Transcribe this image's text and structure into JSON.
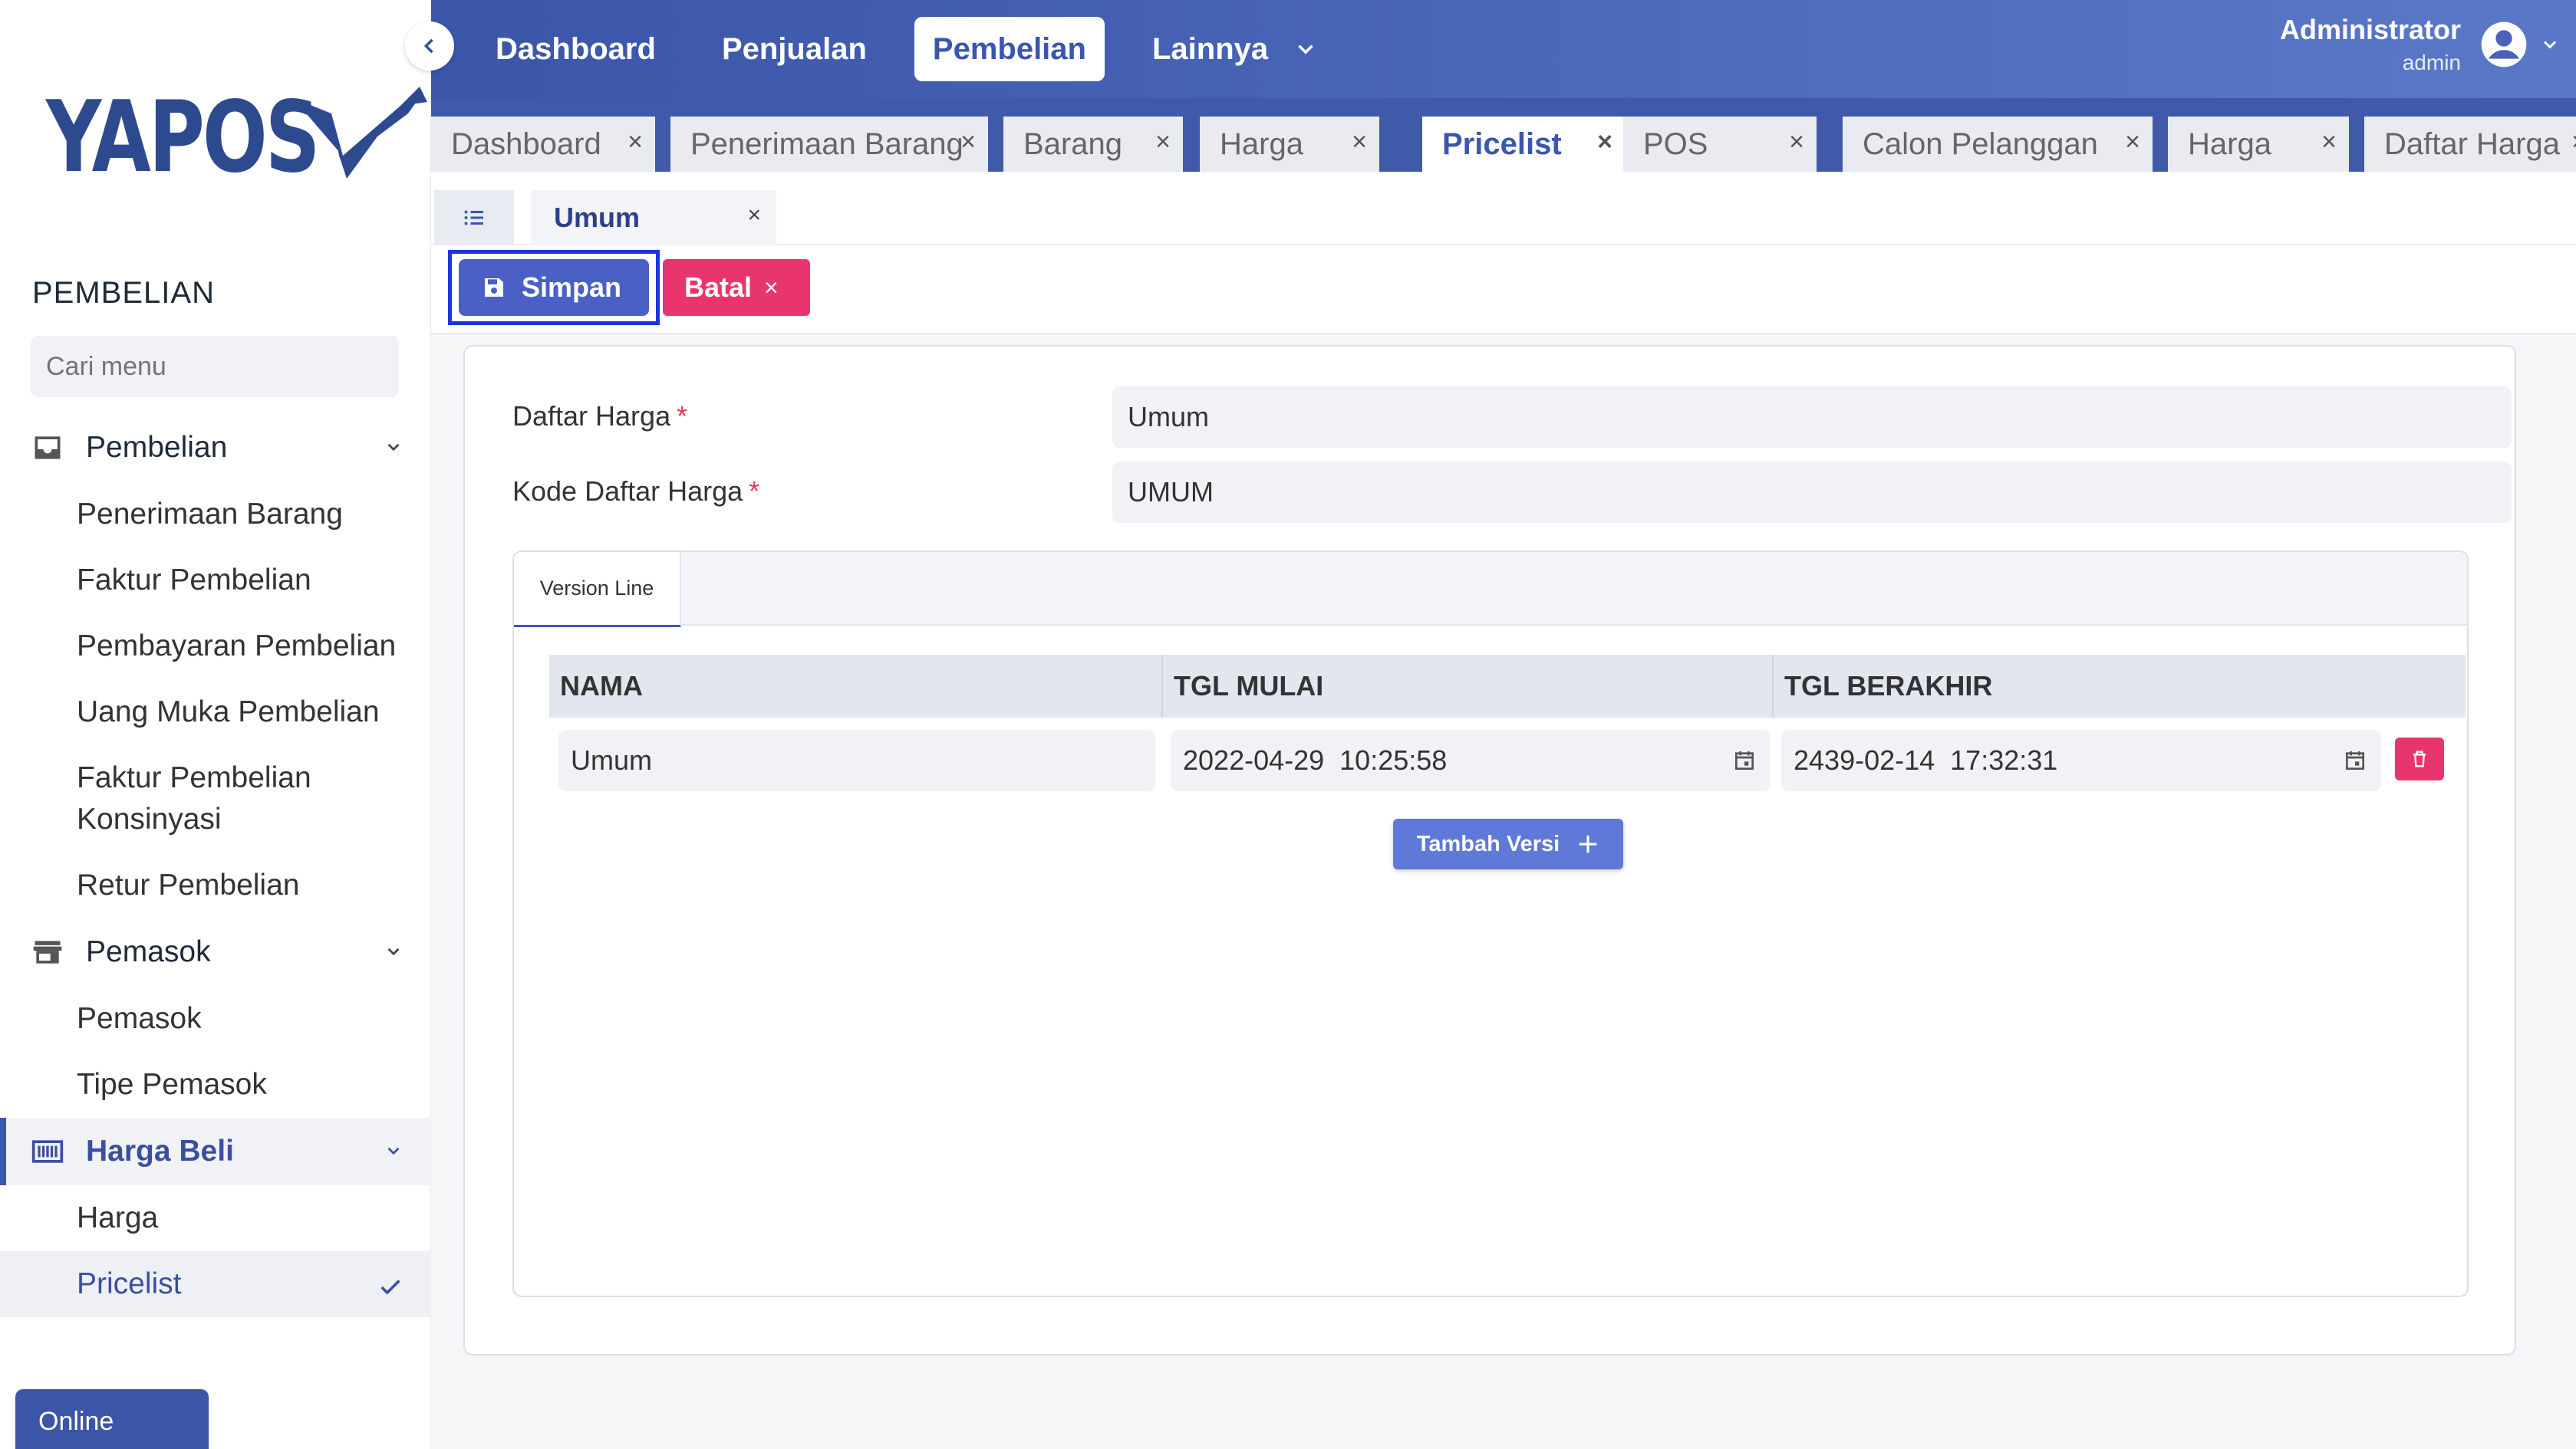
{
  "brand": {
    "name": "YAPOS",
    "color": "#2e4a8f"
  },
  "colors": {
    "primary": "#3b55a8",
    "danger": "#e8356d",
    "accent_btn": "#5e79d8"
  },
  "sidebar": {
    "section_title": "PEMBELIAN",
    "search_placeholder": "Cari menu",
    "groups": [
      {
        "label": "Pembelian",
        "icon": "inbox-tray-icon",
        "items": [
          "Penerimaan Barang",
          "Faktur Pembelian",
          "Pembayaran Pembelian",
          "Uang Muka Pembelian",
          "Faktur Pembelian Konsinyasi",
          "Retur Pembelian"
        ]
      },
      {
        "label": "Pemasok",
        "icon": "store-icon",
        "items": [
          "Pemasok",
          "Tipe Pemasok"
        ]
      },
      {
        "label": "Harga Beli",
        "icon": "barcode-icon",
        "items": [
          "Harga",
          "Pricelist"
        ]
      }
    ],
    "online_label": "Online"
  },
  "topnav": {
    "items": [
      "Dashboard",
      "Penjualan",
      "Pembelian",
      "Lainnya"
    ],
    "active": "Pembelian",
    "user_name": "Administrator",
    "user_role": "admin"
  },
  "tabs": [
    "Dashboard",
    "Penerimaan Barang",
    "Barang",
    "Harga",
    "Pricelist",
    "POS",
    "Calon Pelanggan",
    "Harga",
    "Daftar Harga"
  ],
  "active_tab": "Pricelist",
  "subtab": {
    "label": "Umum"
  },
  "actions": {
    "save": "Simpan",
    "cancel": "Batal"
  },
  "form": {
    "daftar_harga_label": "Daftar Harga",
    "daftar_harga_value": "Umum",
    "kode_label": "Kode Daftar Harga",
    "kode_value": "UMUM",
    "required_mark": "*"
  },
  "version_tab": "Version Line",
  "table": {
    "headers": [
      "NAMA",
      "TGL MULAI",
      "TGL BERAKHIR"
    ],
    "rows": [
      {
        "nama": "Umum",
        "tgl_mulai": "2022-04-29  10:25:58",
        "tgl_berakhir": "2439-02-14  17:32:31"
      }
    ]
  },
  "add_version": "Tambah Versi",
  "close_glyph": "×"
}
